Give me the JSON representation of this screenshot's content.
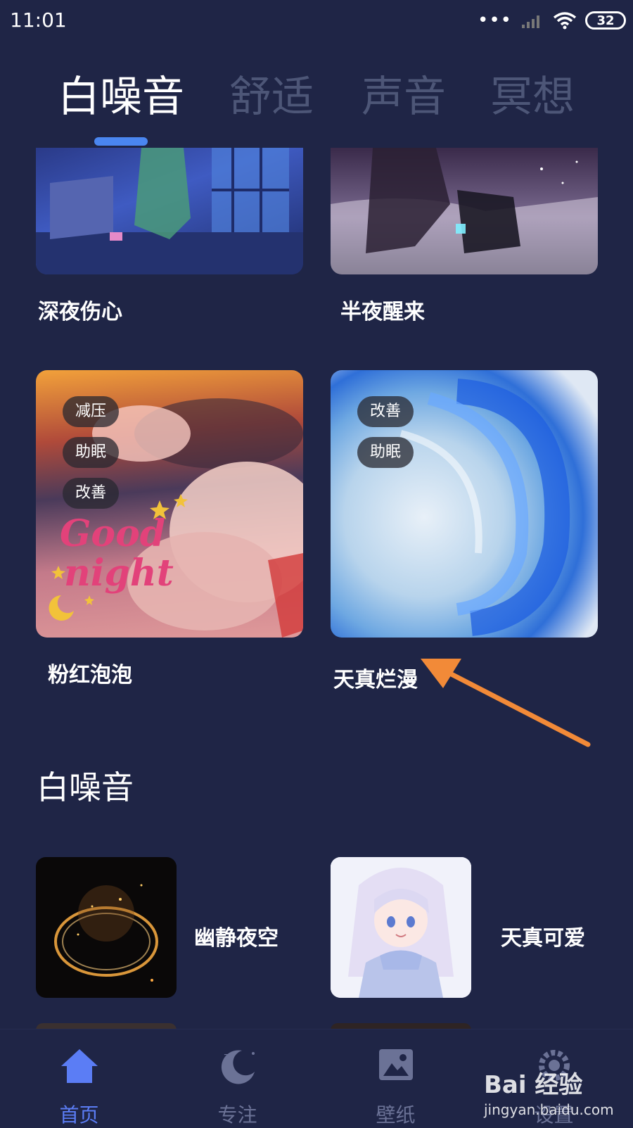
{
  "status_bar": {
    "time": "11:01",
    "battery": "32"
  },
  "tabs": [
    {
      "label": "白噪音"
    },
    {
      "label": "舒适"
    },
    {
      "label": "声音"
    },
    {
      "label": "冥想"
    }
  ],
  "cards": [
    {
      "title": "深夜伤心"
    },
    {
      "title": "半夜醒来"
    },
    {
      "title": "粉红泡泡",
      "tags": [
        "减压",
        "助眠",
        "改善"
      ],
      "art_text": [
        "Good",
        "night"
      ]
    },
    {
      "title": "天真烂漫",
      "tags": [
        "改善",
        "助眠"
      ]
    }
  ],
  "section": {
    "title": "白噪音"
  },
  "list_items": [
    {
      "title": "幽静夜空"
    },
    {
      "title": "天真可爱"
    }
  ],
  "bottom_nav": [
    {
      "label": "首页",
      "icon": "home-icon",
      "active": true
    },
    {
      "label": "专注",
      "icon": "moon-icon",
      "active": false
    },
    {
      "label": "壁纸",
      "icon": "image-icon",
      "active": false
    },
    {
      "label": "设置",
      "icon": "settings-icon",
      "active": false
    }
  ],
  "watermark": {
    "brand": "Bai 经验",
    "url": "jingyan.baidu.com"
  },
  "colors": {
    "background": "#1f2546",
    "accent": "#4a86f0",
    "active_nav": "#5b7df5",
    "inactive_tab": "#4d5677",
    "arrow": "#f28a38"
  }
}
